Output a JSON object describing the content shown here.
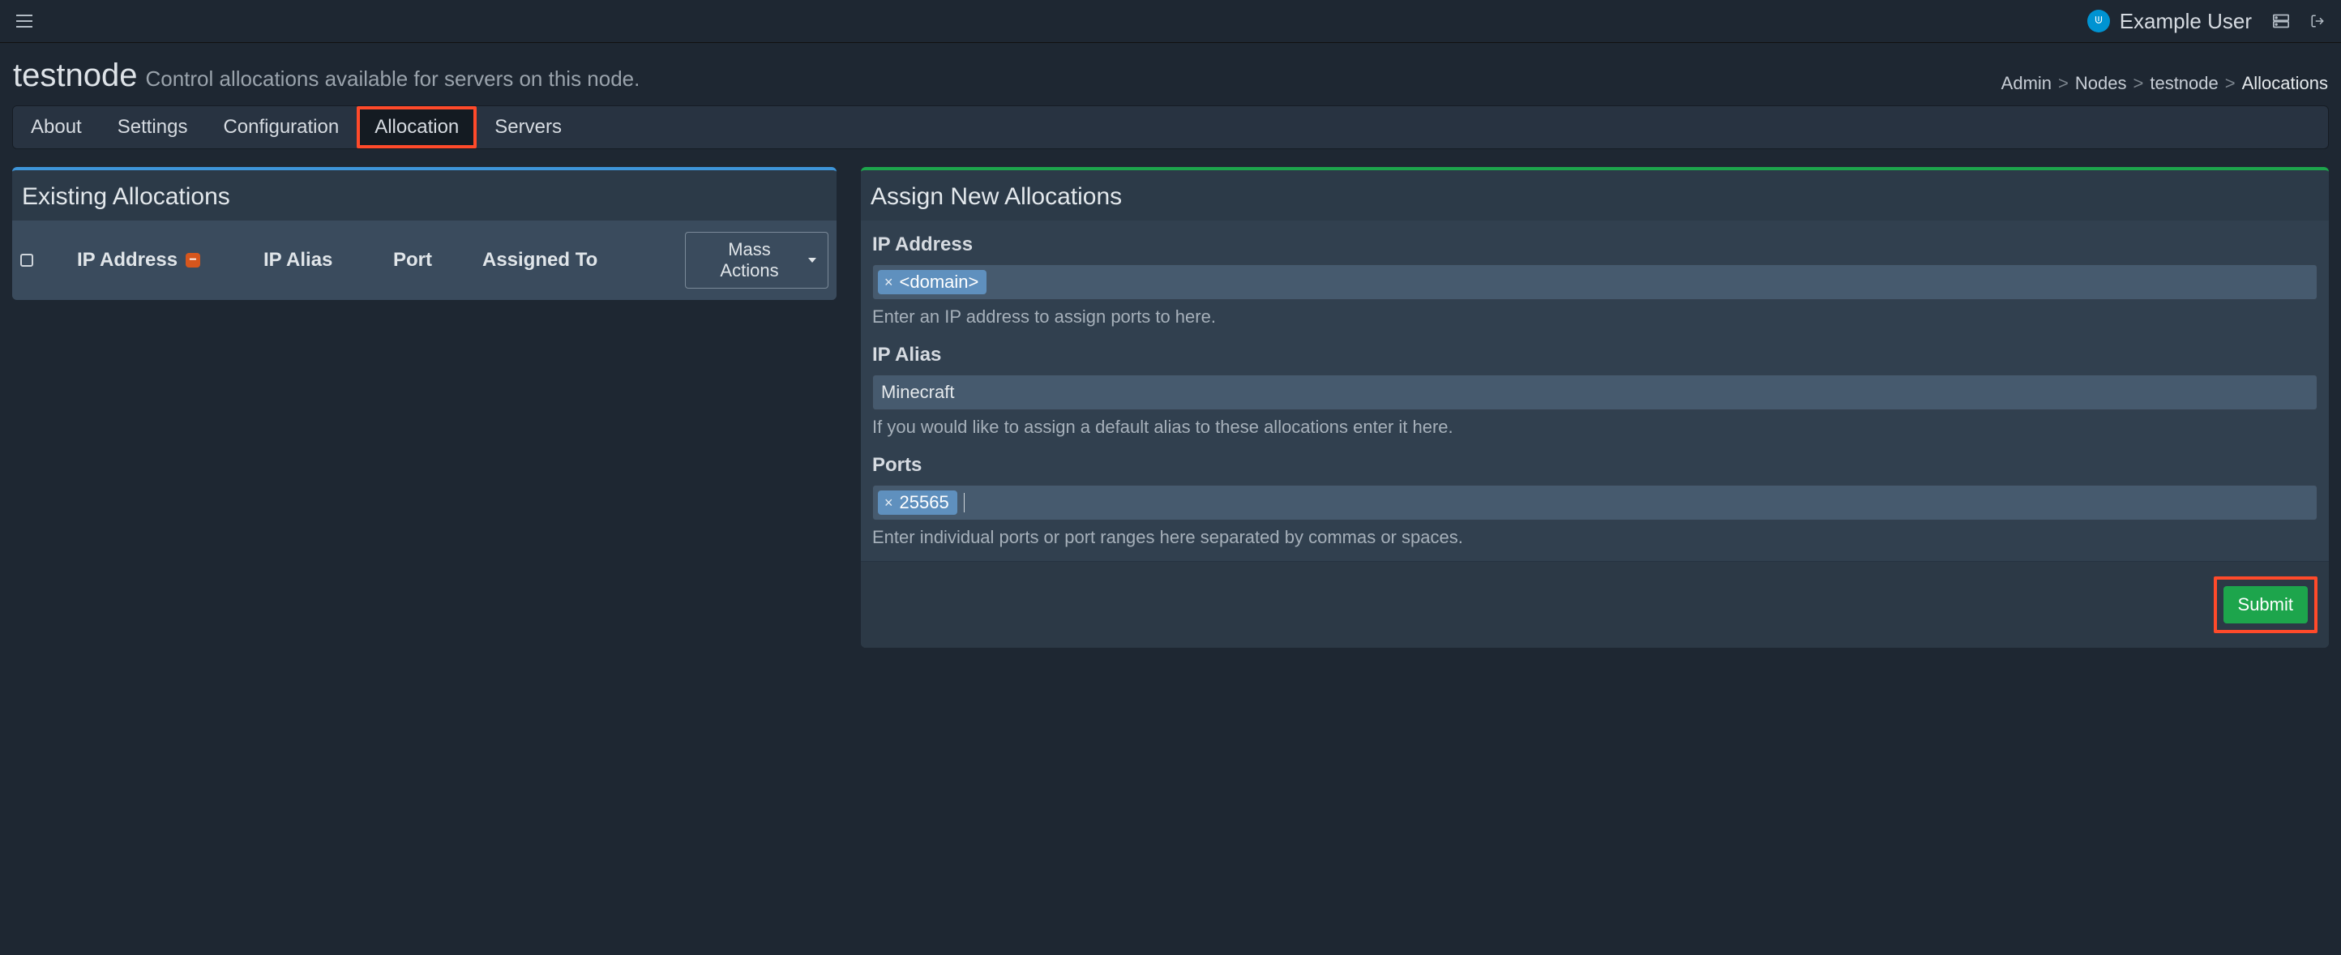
{
  "topbar": {
    "user_name": "Example User"
  },
  "header": {
    "title": "testnode",
    "subtitle": "Control allocations available for servers on this node."
  },
  "breadcrumbs": {
    "items": [
      "Admin",
      "Nodes",
      "testnode",
      "Allocations"
    ]
  },
  "tabs": {
    "items": [
      "About",
      "Settings",
      "Configuration",
      "Allocation",
      "Servers"
    ],
    "active_index": 3
  },
  "left_panel": {
    "title": "Existing Allocations",
    "columns": {
      "ip_address": "IP Address",
      "ip_alias": "IP Alias",
      "port": "Port",
      "assigned_to": "Assigned To"
    },
    "mass_actions_label": "Mass Actions"
  },
  "right_panel": {
    "title": "Assign New Allocations",
    "ip_address": {
      "label": "IP Address",
      "tags": [
        "<domain>"
      ],
      "help": "Enter an IP address to assign ports to here."
    },
    "ip_alias": {
      "label": "IP Alias",
      "value": "Minecraft",
      "help": "If you would like to assign a default alias to these allocations enter it here."
    },
    "ports": {
      "label": "Ports",
      "tags": [
        "25565"
      ],
      "help": "Enter individual ports or port ranges here separated by commas or spaces."
    },
    "submit_label": "Submit"
  }
}
